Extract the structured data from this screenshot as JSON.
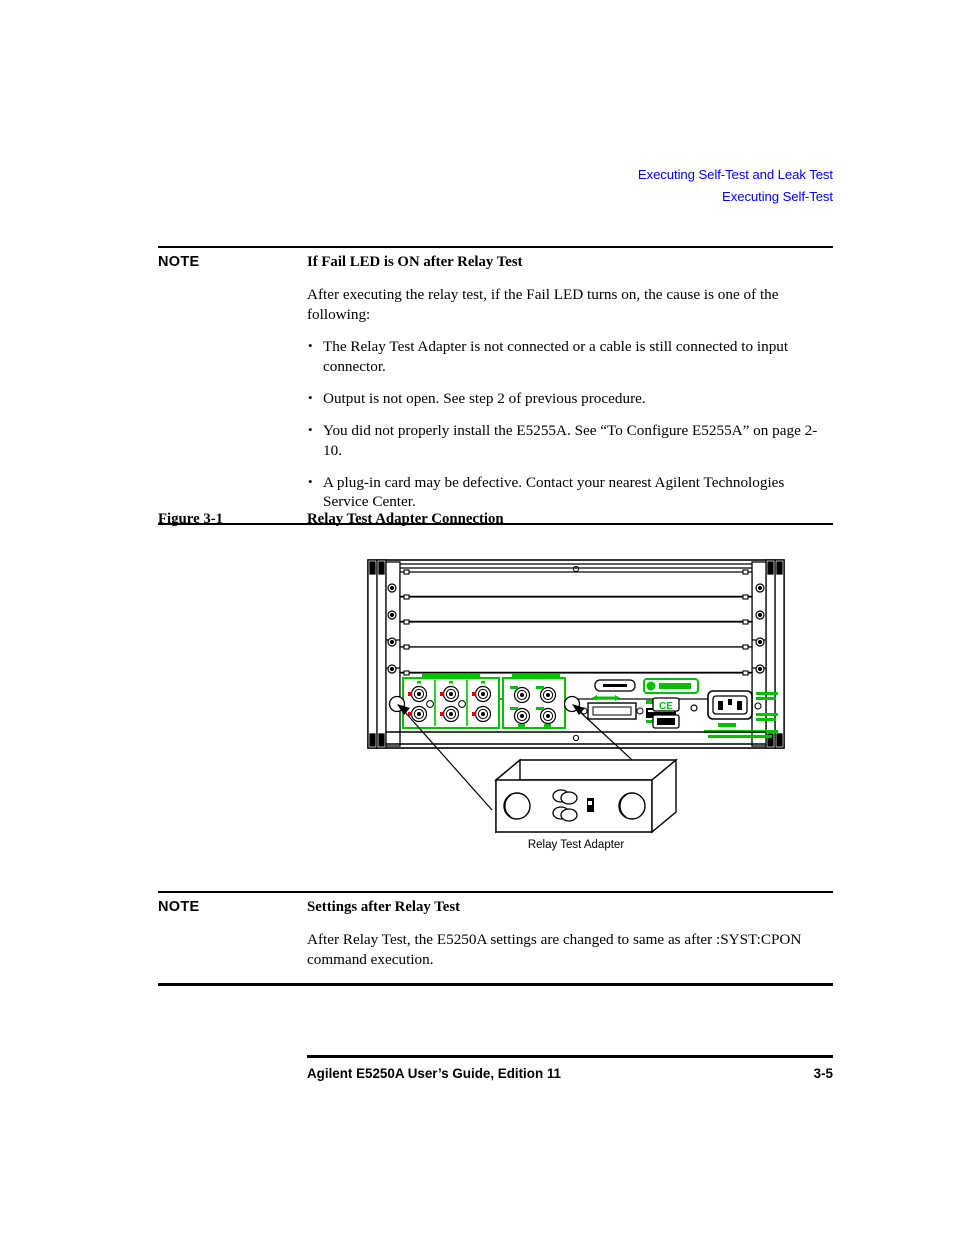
{
  "header": {
    "line1": "Executing Self-Test and Leak Test",
    "line2": "Executing Self-Test"
  },
  "note_top": {
    "label": "NOTE",
    "title": "If Fail LED is ON after Relay Test",
    "paragraph": "After executing the relay test, if the Fail LED turns on, the cause is one of the following:",
    "bullets": [
      "The Relay Test Adapter is not connected or a cable is still connected to input connector.",
      "Output is not open. See step 2 of previous procedure.",
      "You did not properly install the E5255A. See “To Configure E5255A” on page 2-10.",
      "A plug-in card may be defective. Contact your nearest Agilent Technologies Service Center."
    ]
  },
  "figure": {
    "number": "Figure 3-1",
    "title": "Relay Test Adapter Connection",
    "adapter_label": "Relay Test Adapter",
    "panel_color": "#00c000",
    "line_color": "#000000"
  },
  "note_bottom": {
    "label": "NOTE",
    "title": "Settings after Relay Test",
    "paragraph": "After Relay Test, the E5250A settings are changed to same as after :SYST:CPON command execution."
  },
  "footer": {
    "title": "Agilent E5250A User’s Guide, Edition 11",
    "page": "3-5"
  }
}
